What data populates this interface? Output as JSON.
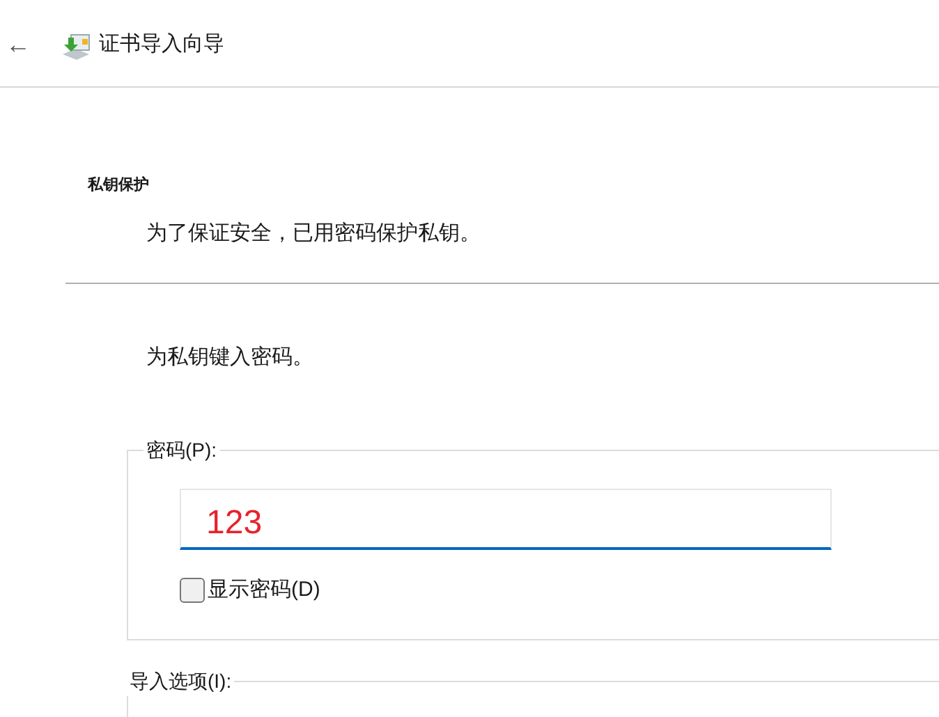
{
  "header": {
    "back": "←",
    "title": "证书导入向导"
  },
  "section": {
    "heading": "私钥保护",
    "description": "为了保证安全，已用密码保护私钥。"
  },
  "prompt": "为私钥键入密码。",
  "password_group": {
    "legend": "密码(P):",
    "value": "123",
    "show_password": {
      "label": "显示密码(D)",
      "checked": false
    }
  },
  "options_group": {
    "legend": "导入选项(I):"
  }
}
